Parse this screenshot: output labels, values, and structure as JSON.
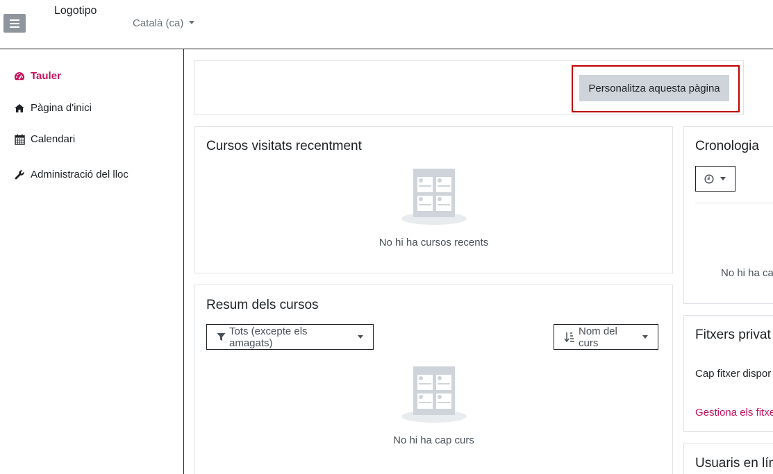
{
  "header": {
    "brand": "Logotipo",
    "language": "Català (ca)"
  },
  "sidebar": {
    "items": [
      {
        "label": "Tauler",
        "icon": "dashboard-icon",
        "active": true
      },
      {
        "label": "Pàgina d'inici",
        "icon": "home-icon"
      },
      {
        "label": "Calendari",
        "icon": "calendar-icon"
      },
      {
        "label": "Administració del lloc",
        "icon": "wrench-icon"
      }
    ]
  },
  "main": {
    "customize_button": "Personalitza aquesta pàgina",
    "recent": {
      "title": "Cursos visitats recentment",
      "empty": "No hi ha cursos recents"
    },
    "overview": {
      "title": "Resum dels cursos",
      "filter": "Tots (excepte els amagats)",
      "sort": "Nom del curs",
      "empty": "No hi ha cap curs"
    }
  },
  "right": {
    "timeline": {
      "title": "Cronologia",
      "empty": "No hi ha ca"
    },
    "private_files": {
      "title": "Fitxers privat",
      "text": "Cap fitxer dispor",
      "link": "Gestiona els fitxe"
    },
    "online_users": {
      "title": "Usuaris en lín"
    }
  },
  "colors": {
    "accent": "#c3125e",
    "highlight_box": "#c00000",
    "button_bg": "#ced4da"
  }
}
